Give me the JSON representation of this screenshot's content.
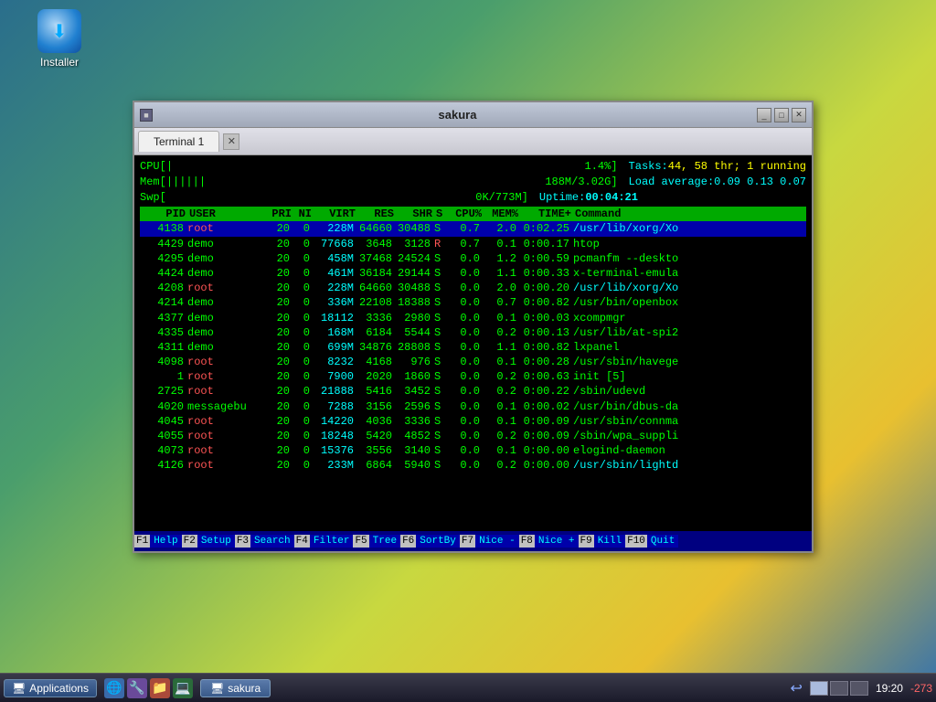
{
  "desktop": {
    "icon": {
      "label": "Installer"
    }
  },
  "window": {
    "title": "sakura",
    "tab_label": "Terminal 1",
    "controls": {
      "minimize": "_",
      "maximize": "□",
      "close": "✕"
    }
  },
  "terminal": {
    "cpu_label": "CPU[",
    "cpu_bar": "|",
    "cpu_value": "1.4%]",
    "mem_label": "Mem[",
    "mem_bar": "||||||",
    "mem_value": "188M/3.02G]",
    "swp_label": "Swp[",
    "swp_value": "0K/773M]",
    "tasks_label": "Tasks: ",
    "tasks_value": "44, 58 thr; 1 running",
    "load_label": "Load average: ",
    "load_value": "0.09 0.13 0.07",
    "uptime_label": "Uptime: ",
    "uptime_value": "00:04:21",
    "columns": [
      "PID",
      "USER",
      "PRI",
      "NI",
      "VIRT",
      "RES",
      "SHR",
      "S",
      "CPU%",
      "MEM%",
      "TIME+",
      "Command"
    ],
    "processes": [
      {
        "pid": "4138",
        "user": "root",
        "pri": "20",
        "ni": "0",
        "virt": "228M",
        "res": "64660",
        "shr": "30488",
        "s": "S",
        "cpu": "0.7",
        "mem": "2.0",
        "time": "0:02.25",
        "cmd": "/usr/lib/xorg/Xo",
        "selected": true
      },
      {
        "pid": "4429",
        "user": "demo",
        "pri": "20",
        "ni": "0",
        "virt": "77668",
        "res": "3648",
        "shr": "3128",
        "s": "R",
        "cpu": "0.7",
        "mem": "0.1",
        "time": "0:00.17",
        "cmd": "htop",
        "highlight": true
      },
      {
        "pid": "4295",
        "user": "demo",
        "pri": "20",
        "ni": "0",
        "virt": "458M",
        "res": "37468",
        "shr": "24524",
        "s": "S",
        "cpu": "0.0",
        "mem": "1.2",
        "time": "0:00.59",
        "cmd": "pcmanfm --deskto"
      },
      {
        "pid": "4424",
        "user": "demo",
        "pri": "20",
        "ni": "0",
        "virt": "461M",
        "res": "36184",
        "shr": "29144",
        "s": "S",
        "cpu": "0.0",
        "mem": "1.1",
        "time": "0:00.33",
        "cmd": "x-terminal-emula"
      },
      {
        "pid": "4208",
        "user": "root",
        "pri": "20",
        "ni": "0",
        "virt": "228M",
        "res": "64660",
        "shr": "30488",
        "s": "S",
        "cpu": "0.0",
        "mem": "2.0",
        "time": "0:00.20",
        "cmd": "/usr/lib/xorg/Xo",
        "cmd_cyan": true
      },
      {
        "pid": "4214",
        "user": "demo",
        "pri": "20",
        "ni": "0",
        "virt": "336M",
        "res": "22108",
        "shr": "18388",
        "s": "S",
        "cpu": "0.0",
        "mem": "0.7",
        "time": "0:00.82",
        "cmd": "/usr/bin/openbox"
      },
      {
        "pid": "4377",
        "user": "demo",
        "pri": "20",
        "ni": "0",
        "virt": "18112",
        "res": "3336",
        "shr": "2980",
        "s": "S",
        "cpu": "0.0",
        "mem": "0.1",
        "time": "0:00.03",
        "cmd": "xcompmgr"
      },
      {
        "pid": "4335",
        "user": "demo",
        "pri": "20",
        "ni": "0",
        "virt": "168M",
        "res": "6184",
        "shr": "5544",
        "s": "S",
        "cpu": "0.0",
        "mem": "0.2",
        "time": "0:00.13",
        "cmd": "/usr/lib/at-spi2"
      },
      {
        "pid": "4311",
        "user": "demo",
        "pri": "20",
        "ni": "0",
        "virt": "699M",
        "res": "34876",
        "shr": "28808",
        "s": "S",
        "cpu": "0.0",
        "mem": "1.1",
        "time": "0:00.82",
        "cmd": "lxpanel"
      },
      {
        "pid": "4098",
        "user": "root",
        "pri": "20",
        "ni": "0",
        "virt": "8232",
        "res": "4168",
        "shr": "976",
        "s": "S",
        "cpu": "0.0",
        "mem": "0.1",
        "time": "0:00.28",
        "cmd": "/usr/sbin/havege"
      },
      {
        "pid": "1",
        "user": "root",
        "pri": "20",
        "ni": "0",
        "virt": "7900",
        "res": "2020",
        "shr": "1860",
        "s": "S",
        "cpu": "0.0",
        "mem": "0.2",
        "time": "0:00.63",
        "cmd": "init [5]"
      },
      {
        "pid": "2725",
        "user": "root",
        "pri": "20",
        "ni": "0",
        "virt": "21888",
        "res": "5416",
        "shr": "3452",
        "s": "S",
        "cpu": "0.0",
        "mem": "0.2",
        "time": "0:00.22",
        "cmd": "/sbin/udevd"
      },
      {
        "pid": "4020",
        "user": "messagebu",
        "pri": "20",
        "ni": "0",
        "virt": "7288",
        "res": "3156",
        "shr": "2596",
        "s": "S",
        "cpu": "0.0",
        "mem": "0.1",
        "time": "0:00.02",
        "cmd": "/usr/bin/dbus-da"
      },
      {
        "pid": "4045",
        "user": "root",
        "pri": "20",
        "ni": "0",
        "virt": "14220",
        "res": "4036",
        "shr": "3336",
        "s": "S",
        "cpu": "0.0",
        "mem": "0.1",
        "time": "0:00.09",
        "cmd": "/usr/sbin/connma"
      },
      {
        "pid": "4055",
        "user": "root",
        "pri": "20",
        "ni": "0",
        "virt": "18248",
        "res": "5420",
        "shr": "4852",
        "s": "S",
        "cpu": "0.0",
        "mem": "0.2",
        "time": "0:00.09",
        "cmd": "/sbin/wpa_suppli"
      },
      {
        "pid": "4073",
        "user": "root",
        "pri": "20",
        "ni": "0",
        "virt": "15376",
        "res": "3556",
        "shr": "3140",
        "s": "S",
        "cpu": "0.0",
        "mem": "0.1",
        "time": "0:00.00",
        "cmd": "elogind-daemon"
      },
      {
        "pid": "4126",
        "user": "root",
        "pri": "20",
        "ni": "0",
        "virt": "233M",
        "res": "6864",
        "shr": "5940",
        "s": "S",
        "cpu": "0.0",
        "mem": "0.2",
        "time": "0:00.00",
        "cmd": "/usr/sbin/lightd",
        "cmd_cyan": true
      }
    ]
  },
  "fnbar": [
    {
      "num": "F1",
      "label": "Help"
    },
    {
      "num": "F2",
      "label": "Setup"
    },
    {
      "num": "F3",
      "label": "Search"
    },
    {
      "num": "F4",
      "label": "Filter"
    },
    {
      "num": "F5",
      "label": "Tree"
    },
    {
      "num": "F6",
      "label": "SortBy"
    },
    {
      "num": "F7",
      "label": "Nice -"
    },
    {
      "num": "F8",
      "label": "Nice +"
    },
    {
      "num": "F9",
      "label": "Kill"
    },
    {
      "num": "F10",
      "label": "Quit"
    }
  ],
  "taskbar": {
    "apps_label": "Applications",
    "window_label": "sakura",
    "time": "19:20",
    "battery": "-273"
  }
}
